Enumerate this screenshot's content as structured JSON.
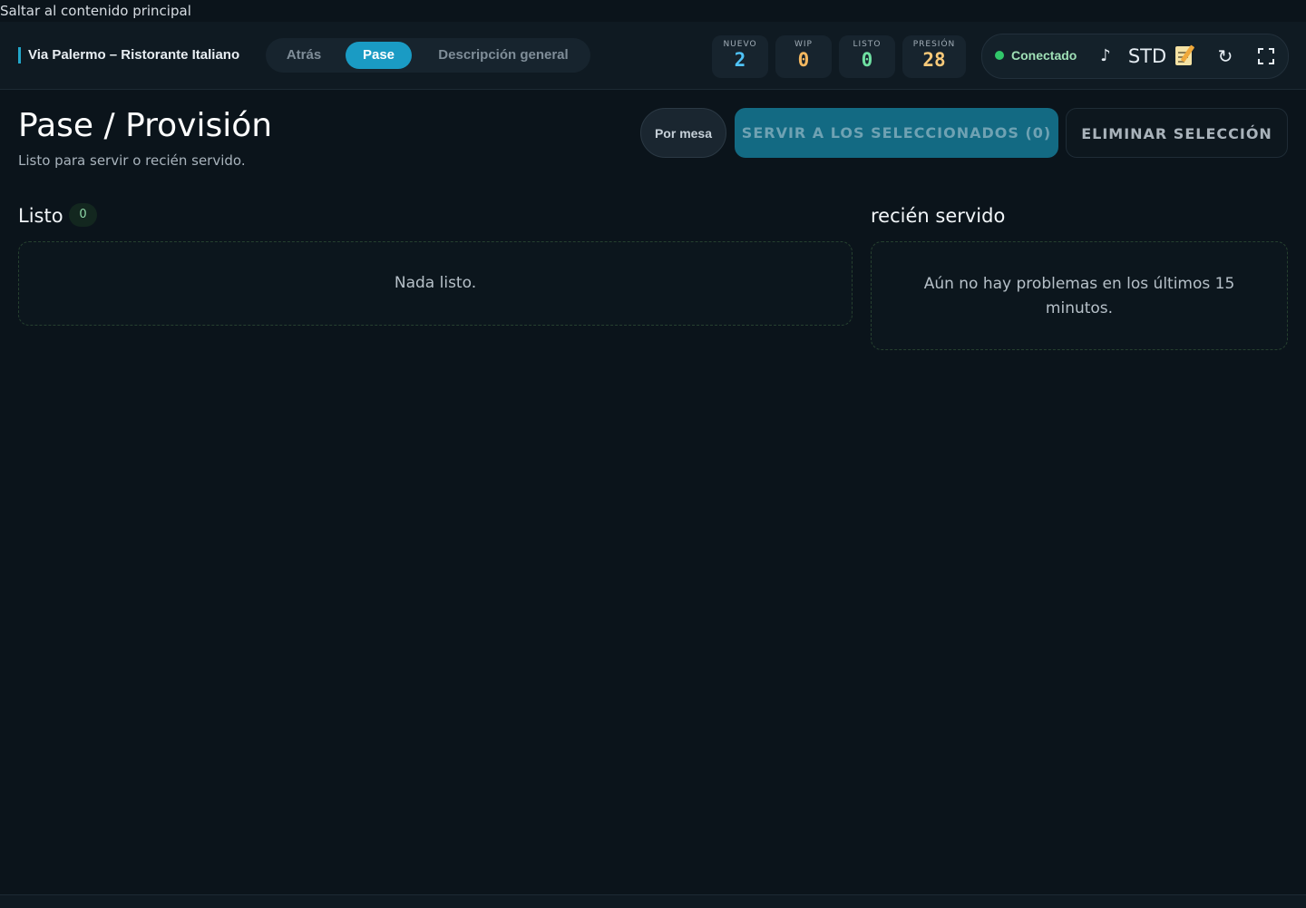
{
  "skip_link": "Saltar al contenido principal",
  "topbar": {
    "brand": "Via Palermo – Ristorante Italiano",
    "nav": {
      "back": "Atrás",
      "active": "Pase",
      "overview": "Descripción general"
    },
    "stats": [
      {
        "label": "NUEVO",
        "value": "2",
        "color": "#4fc3f7"
      },
      {
        "label": "WIP",
        "value": "0",
        "color": "#f4b860"
      },
      {
        "label": "LISTO",
        "value": "0",
        "color": "#6fe0a2"
      },
      {
        "label": "PRESIÓN",
        "value": "28",
        "color": "#f7c979"
      }
    ],
    "status": {
      "connection": "Conectado",
      "mode": "STD",
      "connection_color": "#31c76a"
    },
    "icons": [
      "music-note-icon",
      "memo-icon",
      "refresh-icon",
      "fullscreen-icon"
    ]
  },
  "header": {
    "title": "Pase / Provisión",
    "subtitle": "Listo para servir o recién servido.",
    "by_table_label": "Por mesa",
    "serve_selected_label": "SERVIR A LOS SELECCIONADOS (0)",
    "clear_selection_label": "ELIMINAR SELECCIÓN"
  },
  "ready": {
    "title": "Listo",
    "count": "0",
    "empty": "Nada listo."
  },
  "served": {
    "title": "recién servido",
    "empty": "Aún no hay problemas en los últimos 15 minutos."
  }
}
